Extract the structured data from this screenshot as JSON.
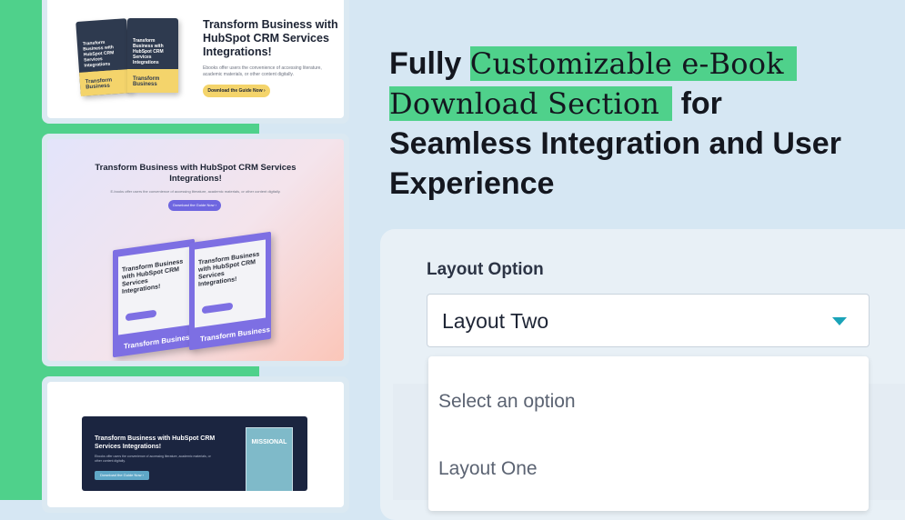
{
  "preview_cards": {
    "card1": {
      "title": "Transform Business with HubSpot CRM Services Integrations!",
      "description": "Ebooks offer users the convenience of accessing literature, academic materials, or other content digitally.",
      "button_label": "Download the Guide Now",
      "book_title": "Transform Business with HubSpot CRM Services Integrations",
      "book_footer": "Transform Business"
    },
    "card2": {
      "title": "Transform Business with HubSpot CRM Services Integrations!",
      "description": "E-books offer users the convenience of accessing literature, academic materials, or other content digitally.",
      "button_label": "Download the Guide Now",
      "book_title": "Transform Business with HubSpot CRM Services Integrations!",
      "book_footer": "Transform Business"
    },
    "card3": {
      "title": "Transform Business with HubSpot CRM Services Integrations!",
      "description": "Ebooks offer users the convenience of accessing literature, academic materials, or other content digitally.",
      "button_label": "Download the Guide Now",
      "book_title": "MISSIONAL"
    }
  },
  "heading": {
    "lead": "Fully",
    "highlight_1": "Customizable e-Book",
    "highlight_2": "Download Section",
    "tail_1": "for",
    "tail_2": "Seamless Integration and User",
    "tail_3": "Experience"
  },
  "layout_setting": {
    "label": "Layout Option",
    "selected": "Layout Two",
    "options": [
      "Select an option",
      "Layout One"
    ]
  },
  "colors": {
    "accent_green": "#4fd18b",
    "background": "#d6e7f3",
    "chevron": "#1aa3b8"
  }
}
